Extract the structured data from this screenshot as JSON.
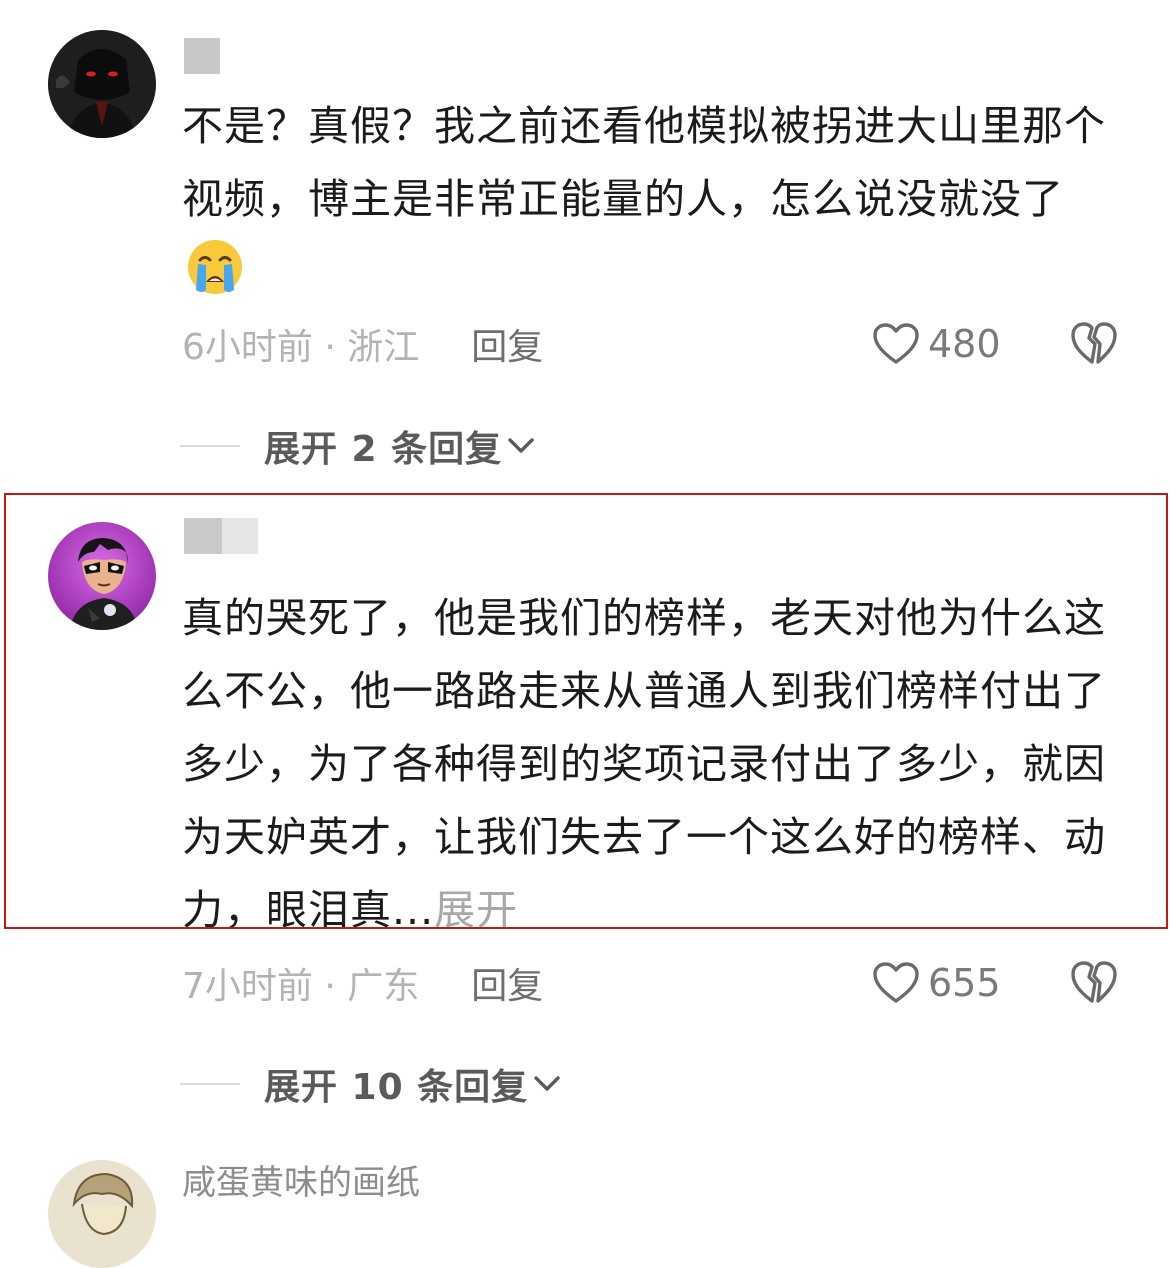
{
  "comments": [
    {
      "username": "",
      "avatar": "dark-masked-figure-avatar",
      "text": "不是？真假？我之前还看他模拟被拐进大山里那个视频，博主是非常正能量的人，怎么说没就没了",
      "emoji": "loudly-crying-face-emoji",
      "time_location": "6小时前 · 浙江",
      "reply_label": "回复",
      "like_count": "480",
      "expand_replies": "展开 2 条回复"
    },
    {
      "username": "",
      "avatar": "masked-hero-purple-avatar",
      "text": "真的哭死了，他是我们的榜样，老天对他为什么这么不公，他一路路走来从普通人到我们榜样付出了多少，为了各种得到的奖项记录付出了多少，就因为天妒英才，让我们失去了一个这么好的榜样、动力，眼泪真...",
      "expand_inline": "展开",
      "time_location": "7小时前 · 广东",
      "reply_label": "回复",
      "like_count": "655",
      "expand_replies": "展开 10 条回复",
      "highlighted": true
    },
    {
      "username": "咸蛋黄味的画纸",
      "avatar": "sketch-character-avatar"
    }
  ],
  "colors": {
    "highlight_border": "#c21818",
    "meta_text": "#b3b3b3",
    "reply_text": "#6e6e6e"
  }
}
